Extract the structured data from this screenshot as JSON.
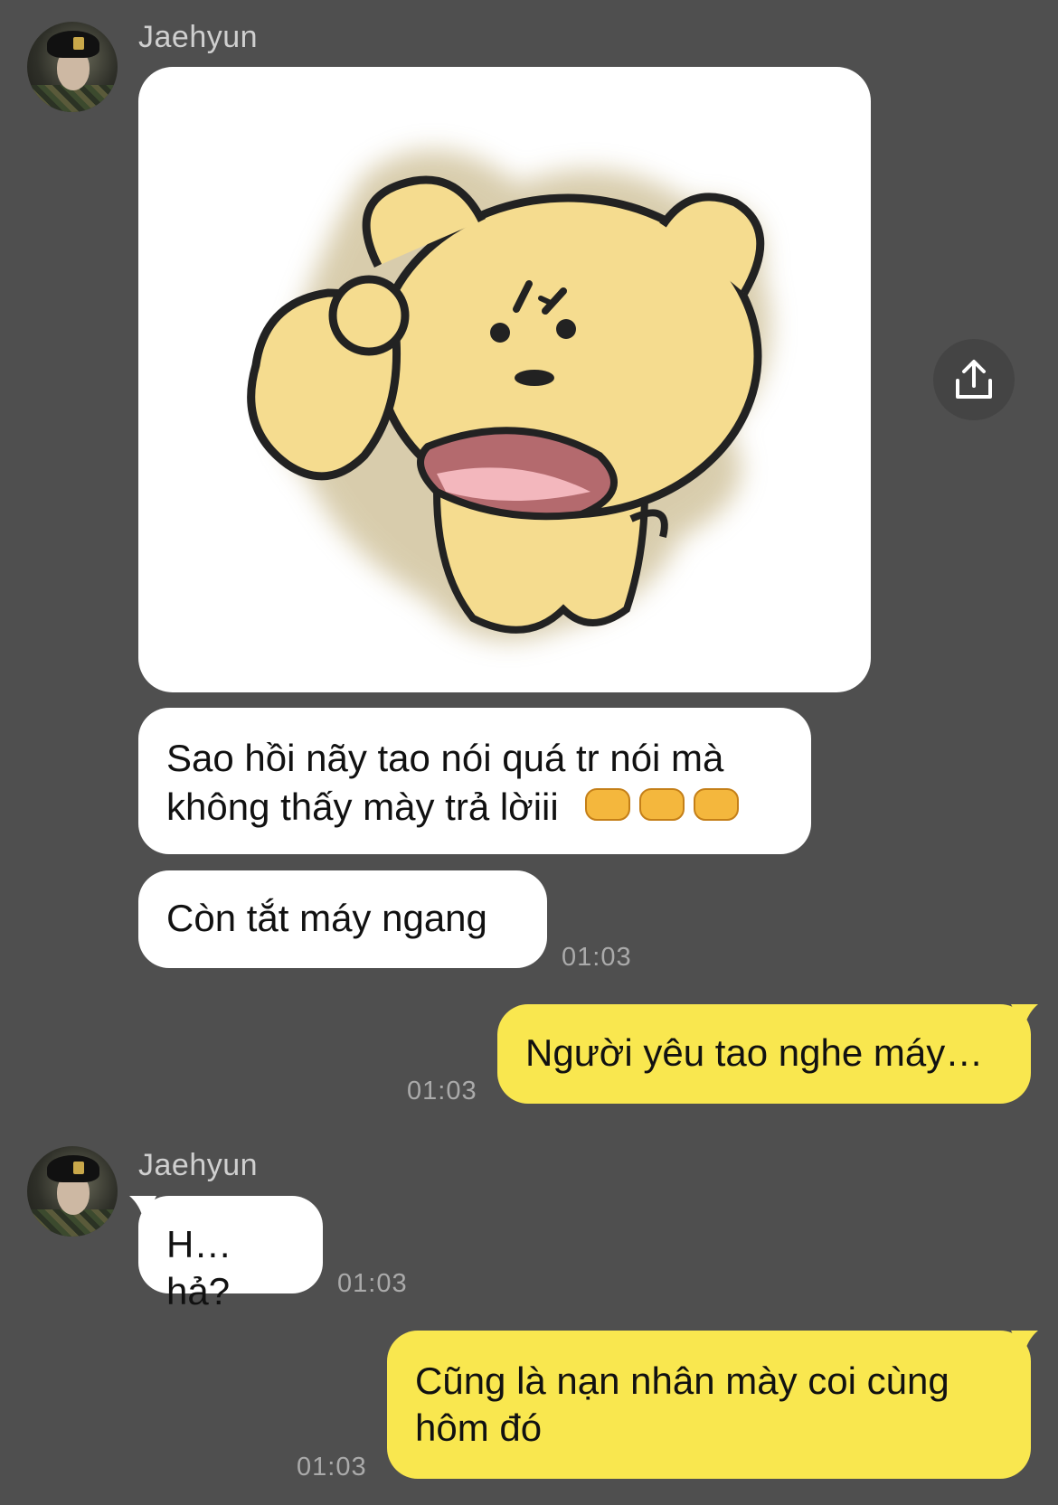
{
  "contact": {
    "name": "Jaehyun"
  },
  "messages": [
    {
      "type": "sticker",
      "sticker_icon": "angry-bear-pointing-sticker"
    },
    {
      "type": "text",
      "line1": "Sao hồi nãy tao nói quá tr nói mà",
      "line2": "không thấy mày trả lờiii",
      "emoji": "👊👊👊"
    },
    {
      "type": "text",
      "text": "Còn tắt máy ngang",
      "time": "01:03"
    },
    {
      "type": "text",
      "text": "Người yêu tao nghe máy…",
      "time": "01:03"
    },
    {
      "type": "text",
      "text": "H…hả?",
      "time": "01:03"
    },
    {
      "type": "text",
      "line1": "Cũng là nạn nhân mày coi cùng",
      "line2": "hôm đó",
      "time": "01:03"
    }
  ],
  "icons": {
    "share": "share-upload-icon",
    "avatar": "contact-avatar"
  },
  "colors": {
    "background": "#4f4f4f",
    "incoming": "#ffffff",
    "outgoing": "#f9e74f",
    "timestamp": "#aaaaaa"
  }
}
